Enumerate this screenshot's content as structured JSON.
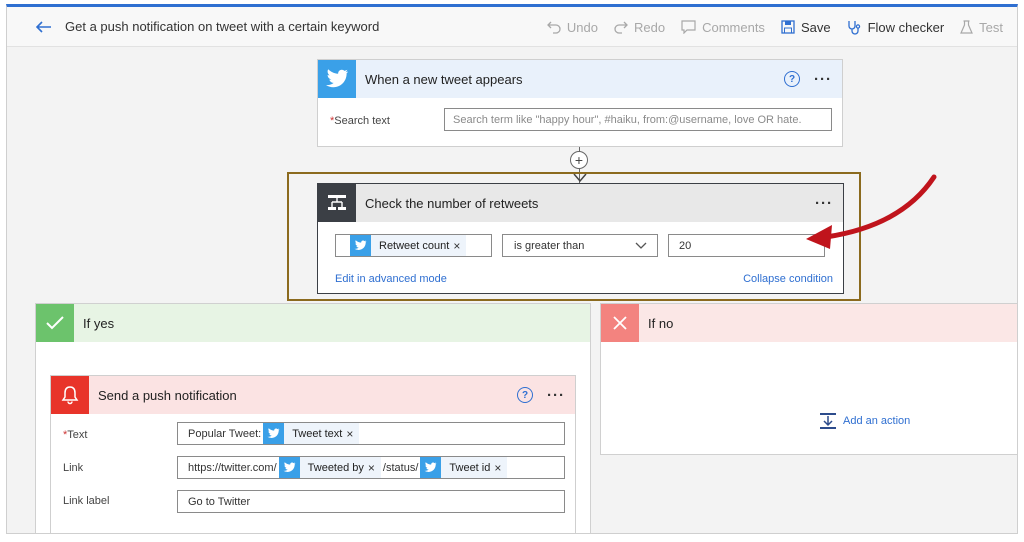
{
  "header": {
    "title": "Get a push notification on tweet with a certain keyword",
    "undo": "Undo",
    "redo": "Redo",
    "comments": "Comments",
    "save": "Save",
    "flow_checker": "Flow checker",
    "test": "Test"
  },
  "trigger": {
    "title": "When a new tweet appears",
    "help": "?",
    "more": "···",
    "search_label": "Search text",
    "search_required": "*",
    "search_placeholder": "Search term like \"happy hour\", #haiku, from:@username, love OR hate."
  },
  "condition": {
    "title": "Check the number of retweets",
    "more": "···",
    "token": "Retweet count",
    "remove": "×",
    "operator": "is greater than",
    "value": "20",
    "edit_advanced": "Edit in advanced mode",
    "collapse": "Collapse condition"
  },
  "branch_yes": {
    "label": "If yes",
    "action": {
      "title": "Send a push notification",
      "help": "?",
      "more": "···",
      "text_label": "Text",
      "text_required": "*",
      "text_prefix": "Popular Tweet:",
      "text_token": "Tweet text",
      "link_label": "Link",
      "link_prefix": "https://twitter.com/",
      "link_token1": "Tweeted by",
      "link_mid": "/status/",
      "link_token2": "Tweet id",
      "linklabel_label": "Link label",
      "linklabel_value": "Go to Twitter",
      "remove": "×"
    }
  },
  "branch_no": {
    "label": "If no",
    "add_action": "Add an action"
  },
  "colors": {
    "accent": "#2f6fd1",
    "twitter": "#3aa0e8",
    "condition_dark": "#3b3f45",
    "yes_green": "#6cc36c",
    "no_red": "#f3837f",
    "alert_red": "#e8342a",
    "highlight_border": "#8b6a1e",
    "arrow_red": "#c0141c"
  }
}
